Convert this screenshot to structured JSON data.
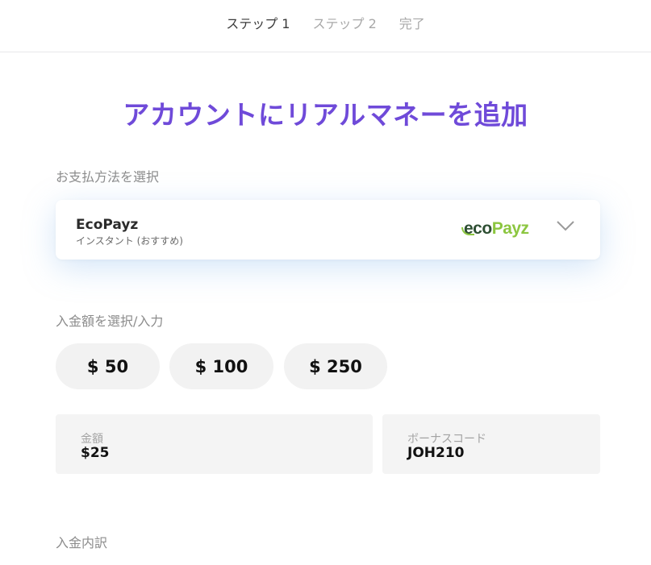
{
  "steps": [
    "ステップ 1",
    "ステップ 2",
    "完了"
  ],
  "title": "アカウントにリアルマネーを追加",
  "payment": {
    "section_label": "お支払方法を選択",
    "method_name": "EcoPayz",
    "method_sub": "インスタント (おすすめ)",
    "logo_eco": "eco",
    "logo_payz": "Payz",
    "logo_colors": {
      "eco": "#2e4f33",
      "payz": "#8cc640"
    }
  },
  "amount": {
    "section_label": "入金額を選択/入力",
    "presets": [
      "$ 50",
      "$ 100",
      "$ 250"
    ],
    "amount_label": "金額",
    "amount_value": "$25",
    "bonus_label": "ボーナスコード",
    "bonus_value": "JOH210"
  },
  "breakdown_label": "入金内訳",
  "colors": {
    "accent": "#6f4ad9",
    "button_bg": "#f2f2f2",
    "field_bg": "#f4f4f4"
  }
}
